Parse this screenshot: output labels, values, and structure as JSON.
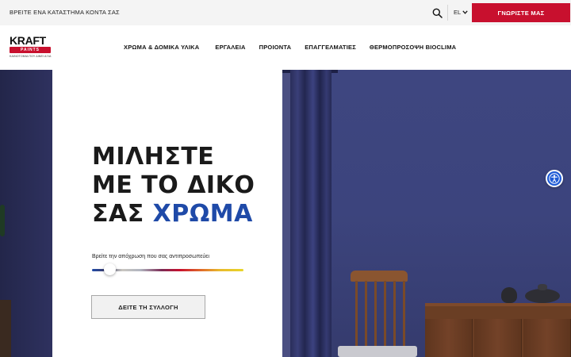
{
  "topbar": {
    "store_link": "ΒΡΕΙΤΕ ΕΝΑ ΚΑΤΑΣΤΗΜΑ ΚΟΝΤΑ ΣΑΣ",
    "language": "EL",
    "cta": "ΓΝΩΡΙΣΤΕ ΜΑΣ",
    "icons": [
      "search-icon",
      "chevron-down-icon"
    ]
  },
  "header": {
    "logo": {
      "wordmark": "KRAFT",
      "band": "PAINTS",
      "tagline": "ΚΑΙΝΟΤΟΜΙΑ ΠΟΥ ΔΙΝΕΙ ΑΞΙΑ"
    },
    "nav": [
      "ΧΡΩΜΑ & ΔΟΜΙΚΑ ΥΛΙΚΑ",
      "ΕΡΓΑΛΕΙΑ",
      "ΠΡΟΙΟΝΤΑ",
      "ΕΠΑΓΓΕΛΜΑΤΙΕΣ",
      "ΘΕΡΜΟΠΡΟΣΟΨΗ BIOCLIMA"
    ]
  },
  "hero": {
    "title_line1": "ΜΙΛΗΣΤΕ",
    "title_line2": "ΜΕ ΤΟ ΔΙΚΟ",
    "title_line3_plain": "ΣΑΣ",
    "title_line3_accent": "ΧΡΩΜΑ",
    "subtitle": "Βρείτε την απόχρωση που σας αντιπροσωπεύει",
    "button": "ΔΕΙΤΕ ΤΗ ΣΥΛΛΟΓΗ",
    "slider_position": 0.12
  },
  "colors": {
    "brand_red": "#c8102e",
    "accent_blue": "#1f4aa8",
    "room_wall": "#3e4680",
    "accessibility_blue": "#1f5bd6"
  },
  "accessibility": {
    "icon": "accessibility-icon"
  }
}
